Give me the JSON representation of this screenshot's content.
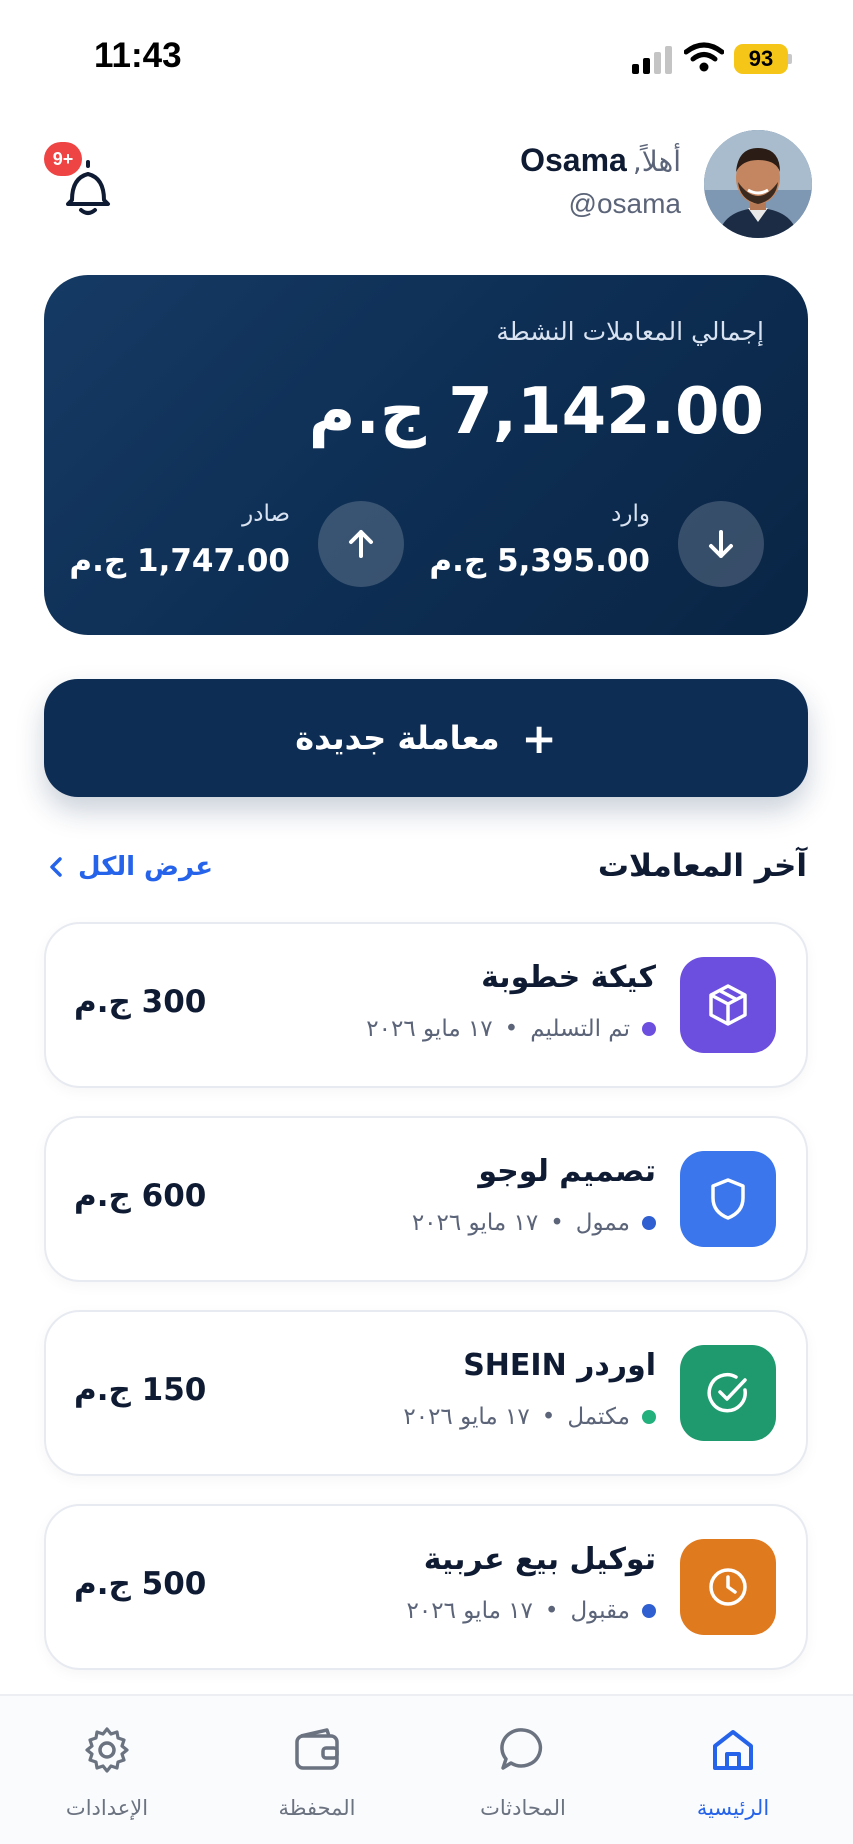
{
  "status_bar": {
    "time": "11:43",
    "battery": "93"
  },
  "header": {
    "greeting": "أهلاً,",
    "name": "Osama",
    "handle": "@osama",
    "notifications_badge": "9+"
  },
  "balance": {
    "label": "إجمالي المعاملات النشطة",
    "total": "7,142.00 ج.م",
    "incoming_label": "وارد",
    "incoming_value": "5,395.00 ج.م",
    "outgoing_label": "صادر",
    "outgoing_value": "1,747.00 ج.م"
  },
  "new_transaction": {
    "label": "معاملة جديدة",
    "plus": "+"
  },
  "recent": {
    "title": "آخر المعاملات",
    "see_all": "عرض الكل",
    "items": [
      {
        "title": "كيكة خطوبة",
        "status": "تم التسليم",
        "date": "١٧ مايو ٢٠٢٦",
        "amount": "300 ج.م",
        "icon": "box-icon",
        "icon_color": "#6d4fe0",
        "dot_color": "#6d4fe0"
      },
      {
        "title": "تصميم لوجو",
        "status": "ممول",
        "date": "١٧ مايو ٢٠٢٦",
        "amount": "600 ج.م",
        "icon": "shield-icon",
        "icon_color": "#3b76ec",
        "dot_color": "#2f5fd0"
      },
      {
        "title": "اوردر SHEIN",
        "status": "مكتمل",
        "date": "١٧ مايو ٢٠٢٦",
        "amount": "150 ج.م",
        "icon": "check-circle-icon",
        "icon_color": "#1f9a6e",
        "dot_color": "#22b07d"
      },
      {
        "title": "توكيل بيع عربية",
        "status": "مقبول",
        "date": "١٧ مايو ٢٠٢٦",
        "amount": "500 ج.م",
        "icon": "clock-icon",
        "icon_color": "#e07a1f",
        "dot_color": "#2f5fd0"
      }
    ]
  },
  "nav": {
    "home": "الرئيسية",
    "chats": "المحادثات",
    "wallet": "المحفظة",
    "settings": "الإعدادات"
  },
  "colors": {
    "accent": "#2563eb",
    "card_dark": "#0e2d55",
    "badge": "#ef4444"
  }
}
